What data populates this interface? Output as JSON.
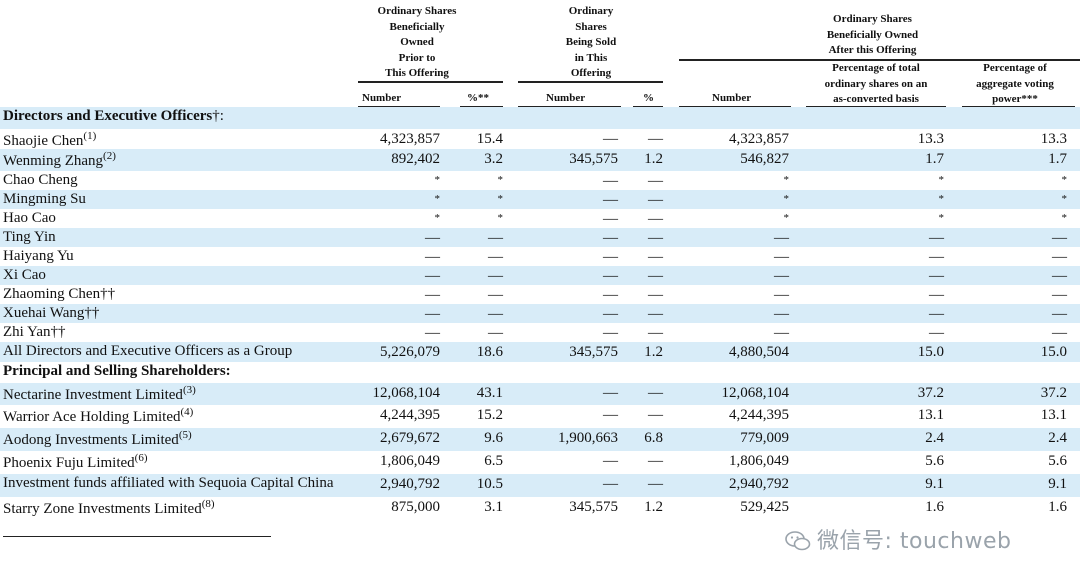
{
  "headers": {
    "prior": [
      "Ordinary Shares",
      "Beneficially",
      "Owned",
      "Prior to",
      "This Offering"
    ],
    "sold": [
      "Ordinary",
      "Shares",
      "Being Sold",
      "in This",
      "Offering"
    ],
    "after": [
      "Ordinary Shares",
      "Beneficially Owned",
      "After this Offering"
    ],
    "after_pct_total": [
      "Percentage of total",
      "ordinary shares on an",
      "as-converted basis"
    ],
    "after_pct_voting": [
      "Percentage of",
      "aggregate voting",
      "power***"
    ],
    "col_number_prior": "Number",
    "col_pct_prior": "%**",
    "col_number_sold": "Number",
    "col_pct_sold": "%",
    "col_number_after": "Number"
  },
  "rows": [
    {
      "type": "section",
      "name": "Directors and Executive Officers",
      "mark": "†",
      "suffix": ":"
    },
    {
      "type": "data",
      "name": "Shaojie Chen",
      "note": "(1)",
      "prior_num": "4,323,857",
      "prior_pct": "15.4",
      "sold_num": "—",
      "sold_pct": "—",
      "after_num": "4,323,857",
      "after_pct_total": "13.3",
      "after_pct_voting": "13.3"
    },
    {
      "type": "data",
      "name": "Wenming Zhang",
      "note": "(2)",
      "prior_num": "892,402",
      "prior_pct": "3.2",
      "sold_num": "345,575",
      "sold_pct": "1.2",
      "after_num": "546,827",
      "after_pct_total": "1.7",
      "after_pct_voting": "1.7"
    },
    {
      "type": "data",
      "name": "Chao Cheng",
      "note": "",
      "prior_num": "*",
      "prior_pct": "*",
      "sold_num": "—",
      "sold_pct": "—",
      "after_num": "*",
      "after_pct_total": "*",
      "after_pct_voting": "*"
    },
    {
      "type": "data",
      "name": "Mingming Su",
      "note": "",
      "prior_num": "*",
      "prior_pct": "*",
      "sold_num": "—",
      "sold_pct": "—",
      "after_num": "*",
      "after_pct_total": "*",
      "after_pct_voting": "*"
    },
    {
      "type": "data",
      "name": "Hao Cao",
      "note": "",
      "prior_num": "*",
      "prior_pct": "*",
      "sold_num": "—",
      "sold_pct": "—",
      "after_num": "*",
      "after_pct_total": "*",
      "after_pct_voting": "*"
    },
    {
      "type": "data",
      "name": "Ting Yin",
      "note": "",
      "prior_num": "—",
      "prior_pct": "—",
      "sold_num": "—",
      "sold_pct": "—",
      "after_num": "—",
      "after_pct_total": "—",
      "after_pct_voting": "—"
    },
    {
      "type": "data",
      "name": "Haiyang Yu",
      "note": "",
      "prior_num": "—",
      "prior_pct": "—",
      "sold_num": "—",
      "sold_pct": "—",
      "after_num": "—",
      "after_pct_total": "—",
      "after_pct_voting": "—"
    },
    {
      "type": "data",
      "name": "Xi Cao",
      "note": "",
      "prior_num": "—",
      "prior_pct": "—",
      "sold_num": "—",
      "sold_pct": "—",
      "after_num": "—",
      "after_pct_total": "—",
      "after_pct_voting": "—"
    },
    {
      "type": "data",
      "name": "Zhaoming Chen††",
      "note": "",
      "prior_num": "—",
      "prior_pct": "—",
      "sold_num": "—",
      "sold_pct": "—",
      "after_num": "—",
      "after_pct_total": "—",
      "after_pct_voting": "—"
    },
    {
      "type": "data",
      "name": "Xuehai Wang††",
      "note": "",
      "prior_num": "—",
      "prior_pct": "—",
      "sold_num": "—",
      "sold_pct": "—",
      "after_num": "—",
      "after_pct_total": "—",
      "after_pct_voting": "—"
    },
    {
      "type": "data",
      "name": "Zhi Yan††",
      "note": "",
      "prior_num": "—",
      "prior_pct": "—",
      "sold_num": "—",
      "sold_pct": "—",
      "after_num": "—",
      "after_pct_total": "—",
      "after_pct_voting": "—"
    },
    {
      "type": "data",
      "name": "All Directors and Executive Officers as a Group",
      "note": "",
      "prior_num": "5,226,079",
      "prior_pct": "18.6",
      "sold_num": "345,575",
      "sold_pct": "1.2",
      "after_num": "4,880,504",
      "after_pct_total": "15.0",
      "after_pct_voting": "15.0"
    },
    {
      "type": "section",
      "name": "Principal and Selling Shareholders:",
      "mark": "",
      "suffix": ""
    },
    {
      "type": "data",
      "name": "Nectarine Investment Limited",
      "note": "(3)",
      "prior_num": "12,068,104",
      "prior_pct": "43.1",
      "sold_num": "—",
      "sold_pct": "—",
      "after_num": "12,068,104",
      "after_pct_total": "37.2",
      "after_pct_voting": "37.2"
    },
    {
      "type": "data",
      "name": "Warrior Ace Holding Limited",
      "note": "(4)",
      "prior_num": "4,244,395",
      "prior_pct": "15.2",
      "sold_num": "—",
      "sold_pct": "—",
      "after_num": "4,244,395",
      "after_pct_total": "13.1",
      "after_pct_voting": "13.1"
    },
    {
      "type": "data",
      "name": "Aodong Investments Limited",
      "note": "(5)",
      "prior_num": "2,679,672",
      "prior_pct": "9.6",
      "sold_num": "1,900,663",
      "sold_pct": "6.8",
      "after_num": "779,009",
      "after_pct_total": "2.4",
      "after_pct_voting": "2.4"
    },
    {
      "type": "data",
      "name": "Phoenix Fuju Limited",
      "note": "(6)",
      "prior_num": "1,806,049",
      "prior_pct": "6.5",
      "sold_num": "—",
      "sold_pct": "—",
      "after_num": "1,806,049",
      "after_pct_total": "5.6",
      "after_pct_voting": "5.6"
    },
    {
      "type": "data",
      "name": "Investment funds affiliated with Sequoia Capital China",
      "note": "",
      "prior_num": "2,940,792",
      "prior_pct": "10.5",
      "sold_num": "—",
      "sold_pct": "—",
      "after_num": "2,940,792",
      "after_pct_total": "9.1",
      "after_pct_voting": "9.1"
    },
    {
      "type": "data",
      "name": "Starry Zone Investments Limited",
      "note": "(8)",
      "prior_num": "875,000",
      "prior_pct": "3.1",
      "sold_num": "345,575",
      "sold_pct": "1.2",
      "after_num": "529,425",
      "after_pct_total": "1.6",
      "after_pct_voting": "1.6"
    }
  ],
  "watermark": {
    "text": "微信号: touchweb",
    "icon": "wechat-icon"
  },
  "colors": {
    "row_shade": "#d8ecf8",
    "watermark": "#9aa3ab"
  }
}
